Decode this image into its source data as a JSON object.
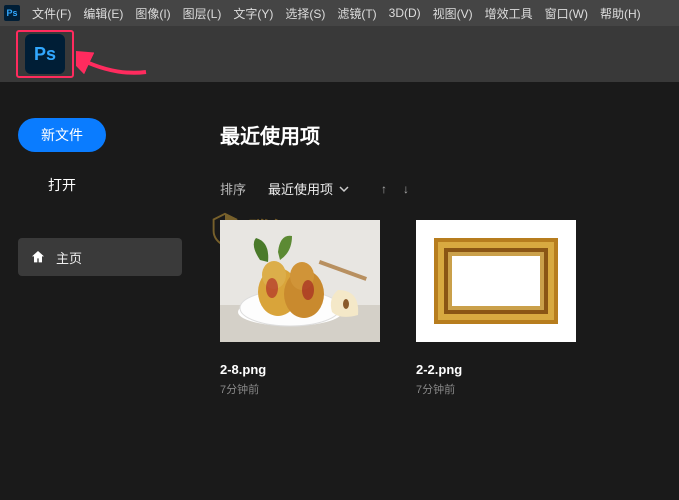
{
  "menubar": {
    "items": [
      "文件(F)",
      "编辑(E)",
      "图像(I)",
      "图层(L)",
      "文字(Y)",
      "选择(S)",
      "滤镜(T)",
      "3D(D)",
      "视图(V)",
      "增效工具",
      "窗口(W)",
      "帮助(H)"
    ]
  },
  "app_logo_text": "Ps",
  "sidebar": {
    "new_file": "新文件",
    "open": "打开",
    "home": "主页"
  },
  "main": {
    "title": "最近使用项",
    "sort_label": "排序",
    "sort_value": "最近使用项",
    "items": [
      {
        "name": "2-8.png",
        "time": "7分钟前"
      },
      {
        "name": "2-2.png",
        "time": "7分钟前"
      }
    ]
  },
  "watermark": {
    "text": "腾轩网"
  }
}
